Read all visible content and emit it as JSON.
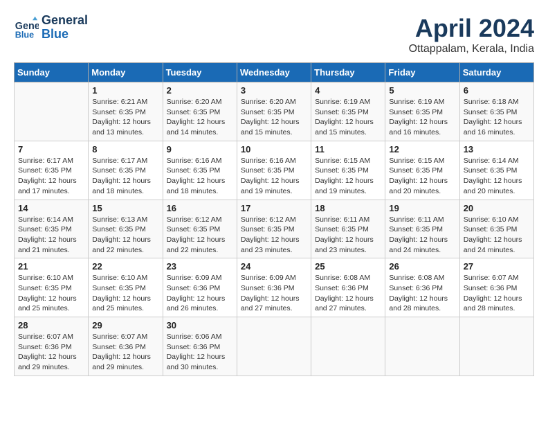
{
  "header": {
    "logo_line1": "General",
    "logo_line2": "Blue",
    "month_title": "April 2024",
    "location": "Ottappalam, Kerala, India"
  },
  "columns": [
    "Sunday",
    "Monday",
    "Tuesday",
    "Wednesday",
    "Thursday",
    "Friday",
    "Saturday"
  ],
  "weeks": [
    [
      {
        "day": "",
        "info": ""
      },
      {
        "day": "1",
        "info": "Sunrise: 6:21 AM\nSunset: 6:35 PM\nDaylight: 12 hours\nand 13 minutes."
      },
      {
        "day": "2",
        "info": "Sunrise: 6:20 AM\nSunset: 6:35 PM\nDaylight: 12 hours\nand 14 minutes."
      },
      {
        "day": "3",
        "info": "Sunrise: 6:20 AM\nSunset: 6:35 PM\nDaylight: 12 hours\nand 15 minutes."
      },
      {
        "day": "4",
        "info": "Sunrise: 6:19 AM\nSunset: 6:35 PM\nDaylight: 12 hours\nand 15 minutes."
      },
      {
        "day": "5",
        "info": "Sunrise: 6:19 AM\nSunset: 6:35 PM\nDaylight: 12 hours\nand 16 minutes."
      },
      {
        "day": "6",
        "info": "Sunrise: 6:18 AM\nSunset: 6:35 PM\nDaylight: 12 hours\nand 16 minutes."
      }
    ],
    [
      {
        "day": "7",
        "info": "Sunrise: 6:17 AM\nSunset: 6:35 PM\nDaylight: 12 hours\nand 17 minutes."
      },
      {
        "day": "8",
        "info": "Sunrise: 6:17 AM\nSunset: 6:35 PM\nDaylight: 12 hours\nand 18 minutes."
      },
      {
        "day": "9",
        "info": "Sunrise: 6:16 AM\nSunset: 6:35 PM\nDaylight: 12 hours\nand 18 minutes."
      },
      {
        "day": "10",
        "info": "Sunrise: 6:16 AM\nSunset: 6:35 PM\nDaylight: 12 hours\nand 19 minutes."
      },
      {
        "day": "11",
        "info": "Sunrise: 6:15 AM\nSunset: 6:35 PM\nDaylight: 12 hours\nand 19 minutes."
      },
      {
        "day": "12",
        "info": "Sunrise: 6:15 AM\nSunset: 6:35 PM\nDaylight: 12 hours\nand 20 minutes."
      },
      {
        "day": "13",
        "info": "Sunrise: 6:14 AM\nSunset: 6:35 PM\nDaylight: 12 hours\nand 20 minutes."
      }
    ],
    [
      {
        "day": "14",
        "info": "Sunrise: 6:14 AM\nSunset: 6:35 PM\nDaylight: 12 hours\nand 21 minutes."
      },
      {
        "day": "15",
        "info": "Sunrise: 6:13 AM\nSunset: 6:35 PM\nDaylight: 12 hours\nand 22 minutes."
      },
      {
        "day": "16",
        "info": "Sunrise: 6:12 AM\nSunset: 6:35 PM\nDaylight: 12 hours\nand 22 minutes."
      },
      {
        "day": "17",
        "info": "Sunrise: 6:12 AM\nSunset: 6:35 PM\nDaylight: 12 hours\nand 23 minutes."
      },
      {
        "day": "18",
        "info": "Sunrise: 6:11 AM\nSunset: 6:35 PM\nDaylight: 12 hours\nand 23 minutes."
      },
      {
        "day": "19",
        "info": "Sunrise: 6:11 AM\nSunset: 6:35 PM\nDaylight: 12 hours\nand 24 minutes."
      },
      {
        "day": "20",
        "info": "Sunrise: 6:10 AM\nSunset: 6:35 PM\nDaylight: 12 hours\nand 24 minutes."
      }
    ],
    [
      {
        "day": "21",
        "info": "Sunrise: 6:10 AM\nSunset: 6:35 PM\nDaylight: 12 hours\nand 25 minutes."
      },
      {
        "day": "22",
        "info": "Sunrise: 6:10 AM\nSunset: 6:35 PM\nDaylight: 12 hours\nand 25 minutes."
      },
      {
        "day": "23",
        "info": "Sunrise: 6:09 AM\nSunset: 6:36 PM\nDaylight: 12 hours\nand 26 minutes."
      },
      {
        "day": "24",
        "info": "Sunrise: 6:09 AM\nSunset: 6:36 PM\nDaylight: 12 hours\nand 27 minutes."
      },
      {
        "day": "25",
        "info": "Sunrise: 6:08 AM\nSunset: 6:36 PM\nDaylight: 12 hours\nand 27 minutes."
      },
      {
        "day": "26",
        "info": "Sunrise: 6:08 AM\nSunset: 6:36 PM\nDaylight: 12 hours\nand 28 minutes."
      },
      {
        "day": "27",
        "info": "Sunrise: 6:07 AM\nSunset: 6:36 PM\nDaylight: 12 hours\nand 28 minutes."
      }
    ],
    [
      {
        "day": "28",
        "info": "Sunrise: 6:07 AM\nSunset: 6:36 PM\nDaylight: 12 hours\nand 29 minutes."
      },
      {
        "day": "29",
        "info": "Sunrise: 6:07 AM\nSunset: 6:36 PM\nDaylight: 12 hours\nand 29 minutes."
      },
      {
        "day": "30",
        "info": "Sunrise: 6:06 AM\nSunset: 6:36 PM\nDaylight: 12 hours\nand 30 minutes."
      },
      {
        "day": "",
        "info": ""
      },
      {
        "day": "",
        "info": ""
      },
      {
        "day": "",
        "info": ""
      },
      {
        "day": "",
        "info": ""
      }
    ]
  ]
}
